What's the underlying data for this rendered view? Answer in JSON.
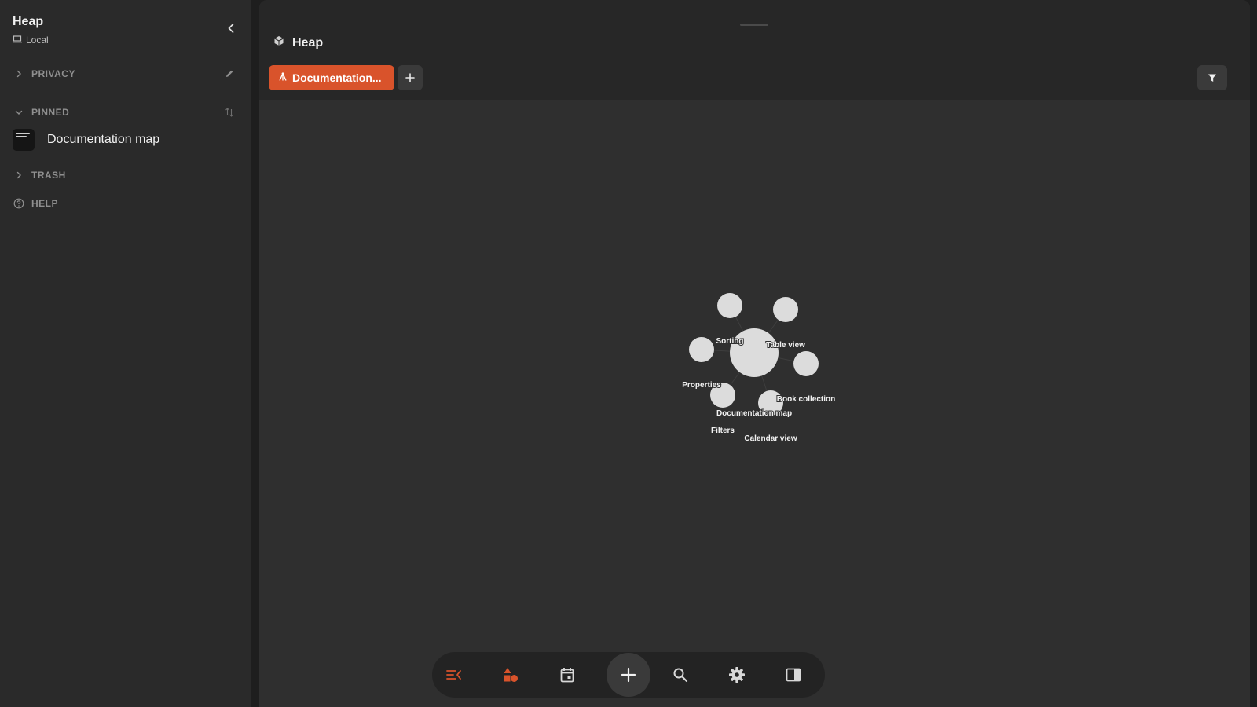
{
  "sidebar": {
    "workspace_title": "Heap",
    "workspace_location": "Local",
    "sections": {
      "privacy": "PRIVACY",
      "pinned": "PINNED",
      "trash": "TRASH",
      "help": "HELP"
    },
    "pinned_items": [
      {
        "label": "Documentation map",
        "thumb_text": "Documentation map"
      }
    ]
  },
  "main": {
    "title": "Heap",
    "active_tab": "Documentation...",
    "accent_color": "#d9532b"
  },
  "graph": {
    "node_labels": {
      "center": "Documentation map",
      "sorting": "Sorting",
      "table_view": "Table view",
      "properties": "Properties",
      "book_collection": "Book collection",
      "filters": "Filters",
      "calendar_view": "Calendar view"
    }
  },
  "dock": {
    "icons": [
      "list-collapse-icon",
      "shapes-icon",
      "calendar-icon",
      "plus-icon",
      "search-icon",
      "gear-icon",
      "sidebar-right-icon"
    ]
  }
}
